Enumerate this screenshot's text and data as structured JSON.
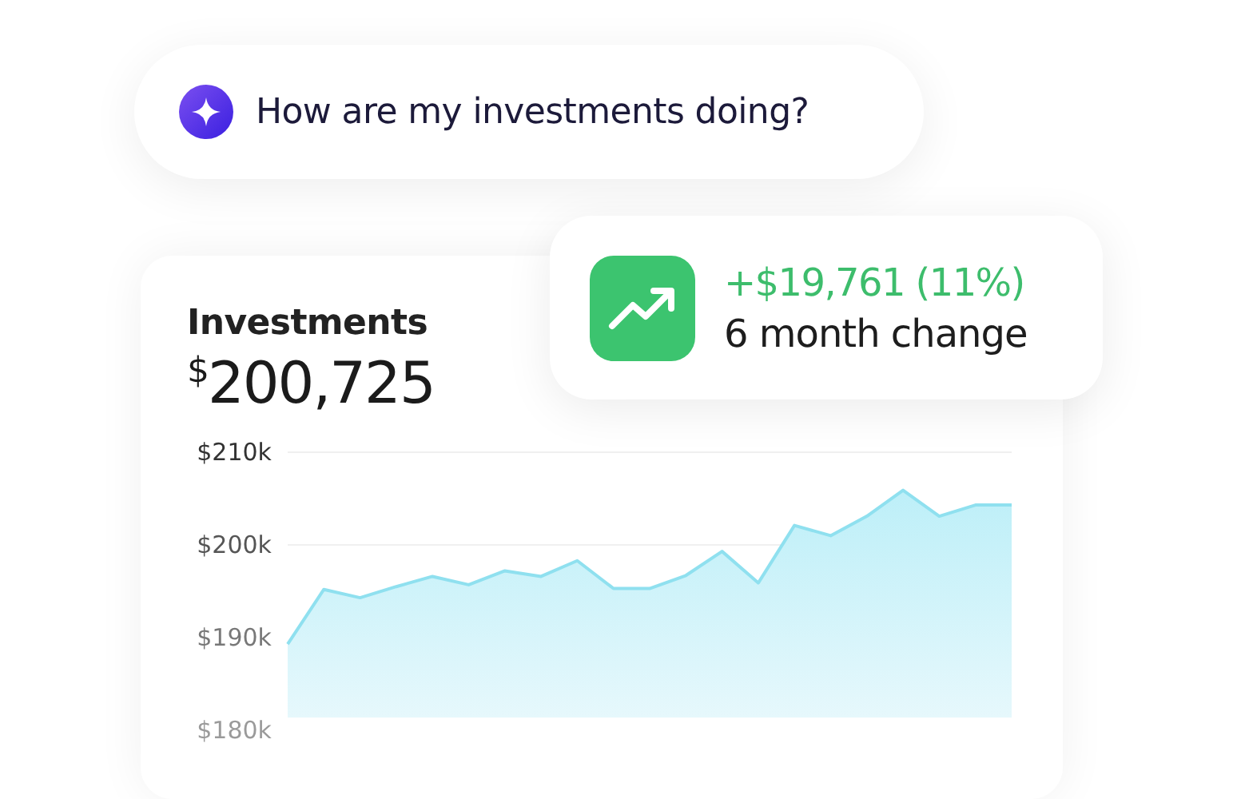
{
  "prompt": {
    "text": "How are my investments doing?"
  },
  "change": {
    "amount": "+$19,761 (11%)",
    "label": "6 month change"
  },
  "card": {
    "title": "Investments",
    "currency": "$",
    "amount": "200,725",
    "chart_data": {
      "type": "area",
      "ylim": [
        180,
        210
      ],
      "yticks": [
        {
          "value": 210,
          "label": "$210k"
        },
        {
          "value": 200,
          "label": "$200k"
        },
        {
          "value": 190,
          "label": "$190k"
        },
        {
          "value": 180,
          "label": "$180k"
        }
      ],
      "series": [
        {
          "color": "#8fe0ef",
          "values": [
            189.3,
            195.2,
            194.3,
            195.5,
            196.6,
            195.7,
            197.2,
            196.6,
            198.3,
            195.3,
            195.3,
            196.7,
            199.3,
            195.9,
            202.1,
            201.0,
            203.1,
            205.9,
            203.1,
            204.3,
            204.3
          ]
        }
      ]
    }
  }
}
